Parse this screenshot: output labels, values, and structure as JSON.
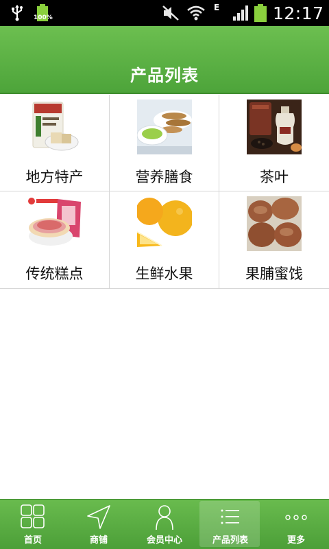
{
  "status_bar": {
    "battery_percent_label": "100%",
    "network_type": "E",
    "time": "12:17"
  },
  "header": {
    "title": "产品列表"
  },
  "products": [
    {
      "label": "地方特产",
      "icon": "local-specialty-image"
    },
    {
      "label": "营养膳食",
      "icon": "nutrition-meal-image"
    },
    {
      "label": "茶叶",
      "icon": "tea-image"
    },
    {
      "label": "传统糕点",
      "icon": "pastry-image"
    },
    {
      "label": "生鲜水果",
      "icon": "fresh-fruit-image"
    },
    {
      "label": "果脯蜜饯",
      "icon": "candied-fruit-image"
    }
  ],
  "bottom_nav": {
    "active": "产品列表",
    "items": [
      {
        "label": "首页",
        "icon": "grid-icon"
      },
      {
        "label": "商铺",
        "icon": "navigation-arrow-icon"
      },
      {
        "label": "会员中心",
        "icon": "person-icon"
      },
      {
        "label": "产品列表",
        "icon": "list-icon"
      },
      {
        "label": "更多",
        "icon": "more-dots-icon"
      }
    ]
  },
  "colors": {
    "header_green": "#5cb346",
    "nav_green": "#5aad42",
    "status_bar": "#000000",
    "battery_green": "#8ad03d"
  }
}
